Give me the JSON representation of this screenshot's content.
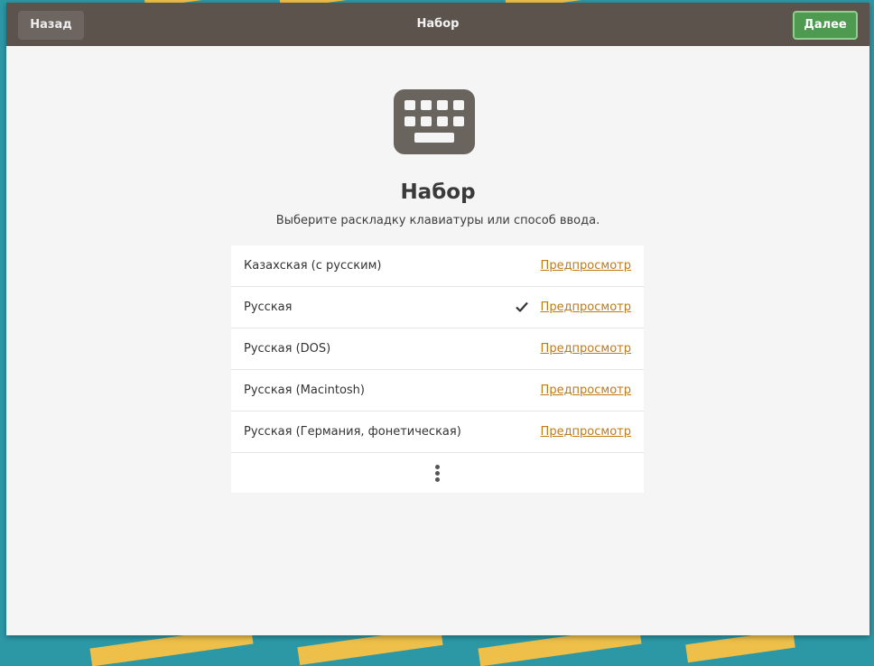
{
  "header": {
    "back_label": "Назад",
    "title": "Набор",
    "next_label": "Далее"
  },
  "main": {
    "icon": "keyboard-icon",
    "title": "Набор",
    "subtitle": "Выберите раскладку клавиатуры или способ ввода."
  },
  "layouts": [
    {
      "label": "Казахская (с русским)",
      "preview": "Предпросмотр",
      "selected": false
    },
    {
      "label": "Русская",
      "preview": "Предпросмотр",
      "selected": true
    },
    {
      "label": "Русская (DOS)",
      "preview": "Предпросмотр",
      "selected": false
    },
    {
      "label": "Русская (Macintosh)",
      "preview": "Предпросмотр",
      "selected": false
    },
    {
      "label": "Русская (Германия, фонетическая)",
      "preview": "Предпросмотр",
      "selected": false
    }
  ],
  "more_icon": "more-vertical-icon",
  "colors": {
    "headerbar": "#5d534d",
    "next_button": "#4d9a50",
    "link": "#c07a16",
    "desktop_bg": "#2c98a6"
  }
}
